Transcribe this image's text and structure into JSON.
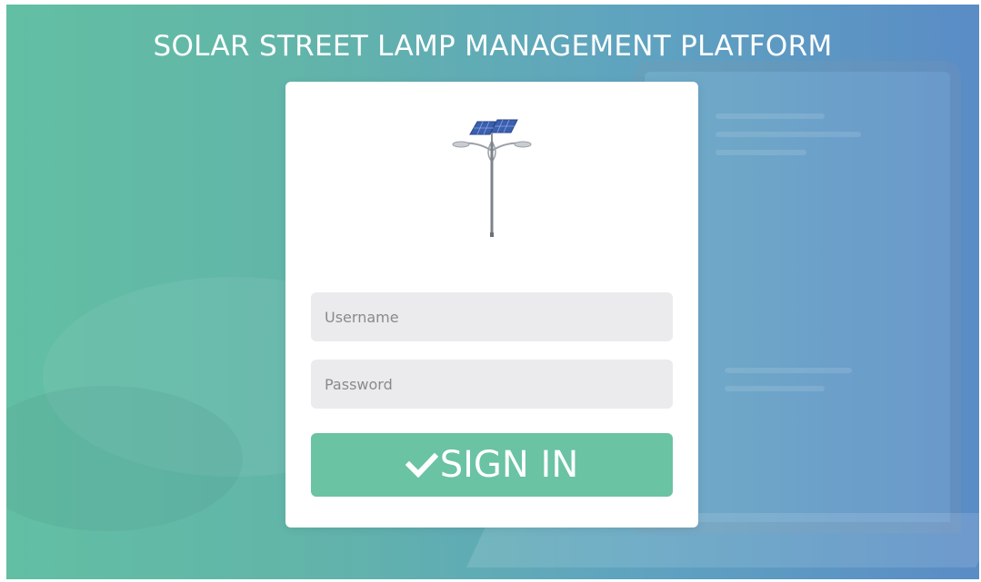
{
  "header": {
    "title": "SOLAR STREET LAMP MANAGEMENT PLATFORM"
  },
  "login": {
    "logo_icon": "solar-street-lamp-icon",
    "username_placeholder": "Username",
    "password_placeholder": "Password",
    "signin_label": "SIGN IN",
    "signin_icon": "checkmark-icon"
  },
  "colors": {
    "background_left": "#62bfa3",
    "background_right": "#5a8cc6",
    "card": "#ffffff",
    "input_background": "#ebebee",
    "button": "#6ac3a3",
    "button_text": "#ffffff"
  }
}
